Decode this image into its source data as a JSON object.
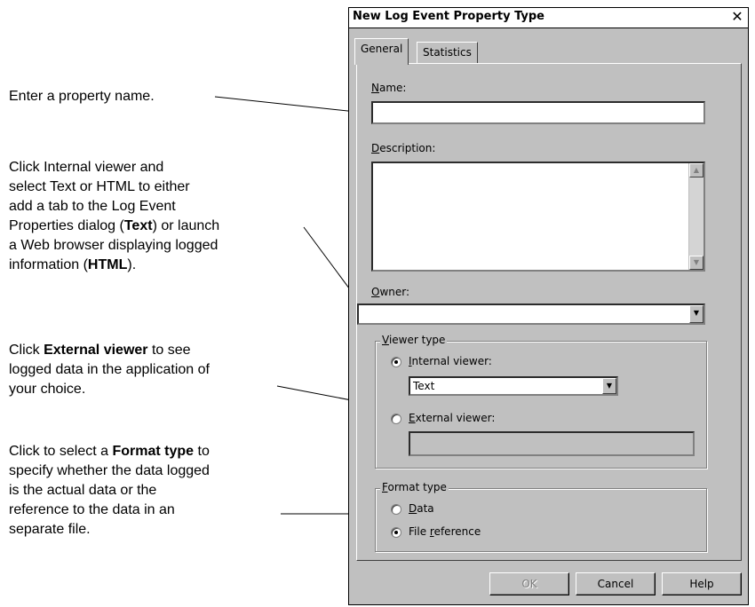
{
  "callouts": {
    "name": "Enter a property name.",
    "viewer_lines": [
      "Click Internal viewer and",
      "select Text or HTML to either",
      "add a tab to the Log Event",
      "Properties dialog (",
      "Text",
      ") or launch",
      "a Web browser displaying logged",
      "information (",
      "HTML",
      ")."
    ],
    "external_pre": "Click ",
    "external_bold": "External viewer",
    "external_post_1": " to see",
    "external_line2": "logged data in the application of",
    "external_line3": "your choice.",
    "format_pre": "Click to select a ",
    "format_bold": "Format type",
    "format_post": " to",
    "format_line2": "specify whether the data logged",
    "format_line3": "is the actual data or the",
    "format_line4": "reference to the data in an",
    "format_line5": "separate file."
  },
  "dialog": {
    "title": "New Log Event Property Type",
    "close_glyph": "✕",
    "tabs": [
      "General",
      "Statistics"
    ],
    "name_label_key": "N",
    "name_label_rest": "ame:",
    "name_value": "",
    "description_label_key": "D",
    "description_label_rest": "escription:",
    "description_value": "",
    "owner_label_key": "O",
    "owner_label_rest": "wner:",
    "owner_value": "",
    "viewer_group_key": "V",
    "viewer_group_rest": "iewer type",
    "internal_key": "I",
    "internal_rest": "nternal viewer:",
    "internal_selected": true,
    "internal_value": "Text",
    "external_key": "E",
    "external_rest": "xternal viewer:",
    "external_selected": false,
    "external_value": "",
    "format_group_key": "F",
    "format_group_rest": "ormat type",
    "format_data_key": "D",
    "format_data_rest": "ata",
    "format_data_selected": false,
    "format_fileref_pre": "File ",
    "format_fileref_key": "r",
    "format_fileref_rest": "eference",
    "format_fileref_selected": true,
    "buttons": {
      "ok": "OK",
      "cancel": "Cancel",
      "help": "Help"
    }
  }
}
